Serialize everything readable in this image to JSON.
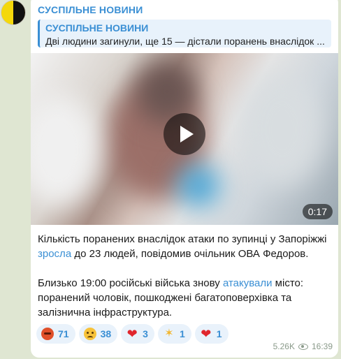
{
  "channel": {
    "name": "СУСПІЛЬНЕ НОВИНИ"
  },
  "reply": {
    "title": "СУСПІЛЬНЕ НОВИНИ",
    "text": "Дві людини загинули, ще 15 — дістали поранень внаслідок ..."
  },
  "video": {
    "duration": "0:17"
  },
  "message": {
    "p1_a": "Кількість поранених внаслідок атаки по зупинці у Запоріжжі ",
    "p1_link": "зросла",
    "p1_b": " до 23 людей, повідомив очільник ОВА Федоров.",
    "p2_a": "Близько 19:00 російські війська знову ",
    "p2_link": "атакували",
    "p2_b": " місто: поранений чоловік, пошкоджені багатоповерхівка та залізнична інфраструктура."
  },
  "reactions": [
    {
      "icon": "angry-face-icon",
      "count": "71"
    },
    {
      "icon": "crying-face-icon",
      "count": "38"
    },
    {
      "icon": "heart-icon",
      "count": "3"
    },
    {
      "icon": "clapping-hands-icon",
      "count": "1"
    },
    {
      "icon": "broken-heart-icon",
      "count": "1"
    }
  ],
  "meta": {
    "views": "5.26K",
    "time": "16:39"
  },
  "colors": {
    "accent": "#3a8fd4",
    "background": "#dfe6d2"
  }
}
